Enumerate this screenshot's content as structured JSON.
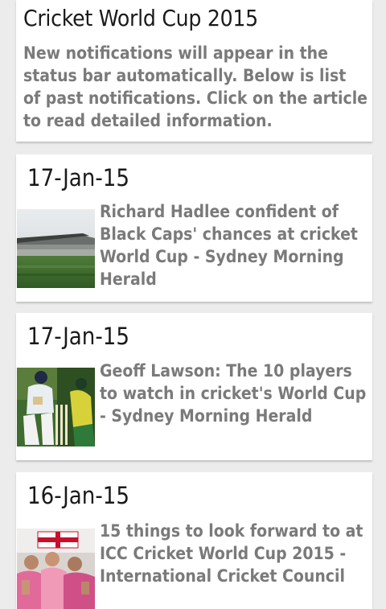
{
  "header": {
    "title": "Cricket World Cup 2015",
    "description_lines": [
      "New notifications will appear in the",
      "status bar automatically. Below is list",
      "of past notifications. Click on the article",
      "to read detailed information."
    ]
  },
  "articles": [
    {
      "date": "17-Jan-15",
      "headline_lines": [
        "Richard Hadlee confident of",
        "Black Caps' chances at cricket",
        "World Cup - Sydney Morning",
        "Herald"
      ],
      "thumbnail": "stadium-photo"
    },
    {
      "date": "17-Jan-15",
      "headline_lines": [
        "Geoff Lawson: The 10 players",
        "to watch in cricket's World Cup",
        "- Sydney Morning Herald"
      ],
      "thumbnail": "batsman-photo"
    },
    {
      "date": "16-Jan-15",
      "headline_lines": [
        "15 things to look forward to at",
        "ICC Cricket World Cup 2015 -",
        "International Cricket Council"
      ],
      "thumbnail": "fans-photo"
    }
  ],
  "colors": {
    "background": "#ececec",
    "card": "#ffffff",
    "title_text": "#1a1a1a",
    "secondary_text": "#7a7a7a"
  }
}
